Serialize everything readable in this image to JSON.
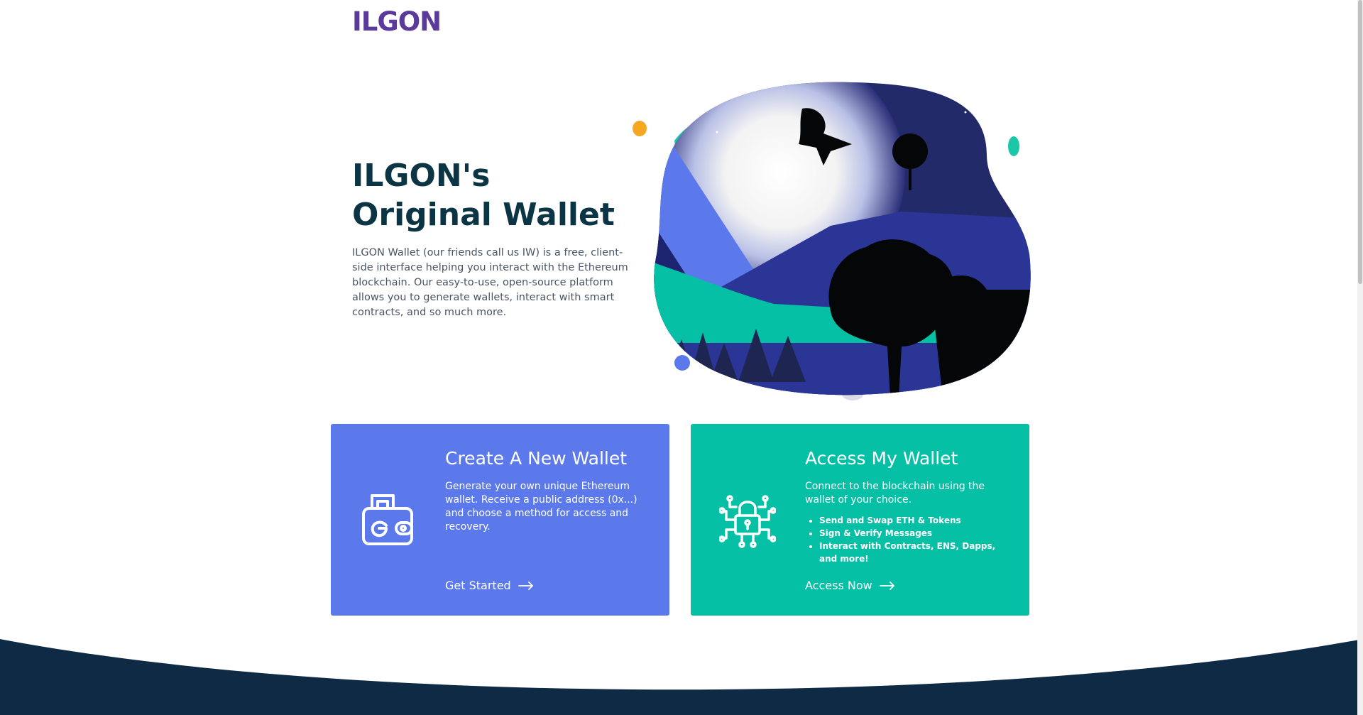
{
  "brand": {
    "logo_text": "ILGON",
    "logo_color": "#5a3a9b"
  },
  "hero": {
    "title_line1": "ILGON's",
    "title_line2": "Original Wallet",
    "description": "ILGON Wallet (our friends call us IW) is a free, client-side interface helping you interact with the Ethereum blockchain. Our easy-to-use, open-source platform allows you to generate wallets, interact with smart contracts, and so much more."
  },
  "illustration": {
    "icon": "dragon-moon-landscape-illustration"
  },
  "cards": {
    "create": {
      "title": "Create A New Wallet",
      "description": "Generate your own unique Ethereum wallet. Receive a public address (0x...) and choose a method for access and recovery.",
      "cta": "Get Started",
      "icon": "wallet-icon",
      "color": "#5c79ec"
    },
    "access": {
      "title": "Access My Wallet",
      "description": "Connect to the blockchain using the wallet of your choice.",
      "bullets": [
        "Send and Swap ETH & Tokens",
        "Sign & Verify Messages",
        "Interact with Contracts, ENS, Dapps, and more!"
      ],
      "cta": "Access Now",
      "icon": "circuit-lock-icon",
      "color": "#05c0a5"
    }
  },
  "colors": {
    "dark_navy": "#0f2a44",
    "heading": "#0b3444"
  }
}
